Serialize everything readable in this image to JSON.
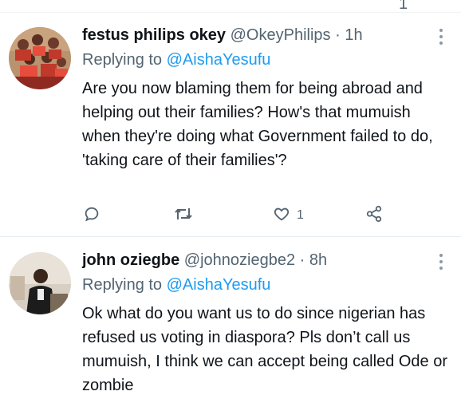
{
  "previous_tweet": {
    "time_fragment": "1"
  },
  "tweets": [
    {
      "display_name": "festus philips okey",
      "handle": "@OkeyPhilips",
      "separator": "·",
      "time": "1h",
      "replying_prefix": "Replying to",
      "replying_to": "@AishaYesufu",
      "text": "Are you now blaming them for being abroad and helping out their families? How's that mumuish when they're doing what Government failed to do, 'taking care of their families'?",
      "like_count": "1",
      "icons": [
        "reply-icon",
        "retweet-icon",
        "like-icon",
        "share-icon",
        "more-icon"
      ]
    },
    {
      "display_name": "john oziegbe",
      "handle": "@johnoziegbe2",
      "separator": "·",
      "time": "8h",
      "replying_prefix": "Replying to",
      "replying_to": "@AishaYesufu",
      "text": "Ok what do you want us to do since nigerian has refused us voting in diaspora? Pls don’t call us mumuish, I think we can accept being called Ode or zombie",
      "icons": [
        "more-icon"
      ]
    }
  ],
  "colors": {
    "accent": "#1d9bf0",
    "secondary_text": "#536471",
    "primary_text": "#0f1419",
    "divider": "#eff3f4"
  }
}
